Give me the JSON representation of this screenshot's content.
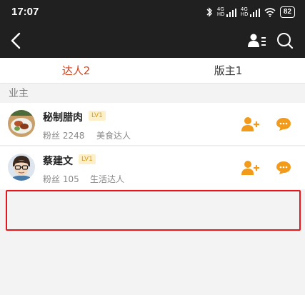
{
  "status": {
    "time": "17:07",
    "battery": "82",
    "signal1": "4G HD",
    "signal2": "4G HD"
  },
  "tabs": [
    {
      "label": "达人2",
      "active": true
    },
    {
      "label": "版主1",
      "active": false
    }
  ],
  "section": {
    "label": "业主"
  },
  "users": [
    {
      "name": "秘制腊肉",
      "level": "LV1",
      "fans": "粉丝 2248",
      "tag": "美食达人"
    },
    {
      "name": "蔡建文",
      "level": "LV1",
      "fans": "粉丝 105",
      "tag": "生活达人"
    }
  ],
  "icons": {
    "back": "chevron-left-icon",
    "user_list": "user-list-icon",
    "search": "search-icon",
    "follow": "add-user-icon",
    "message": "chat-bubble-icon"
  },
  "colors": {
    "accent": "#d6421c",
    "action": "#f29a1a",
    "highlight": "#e8141b"
  }
}
